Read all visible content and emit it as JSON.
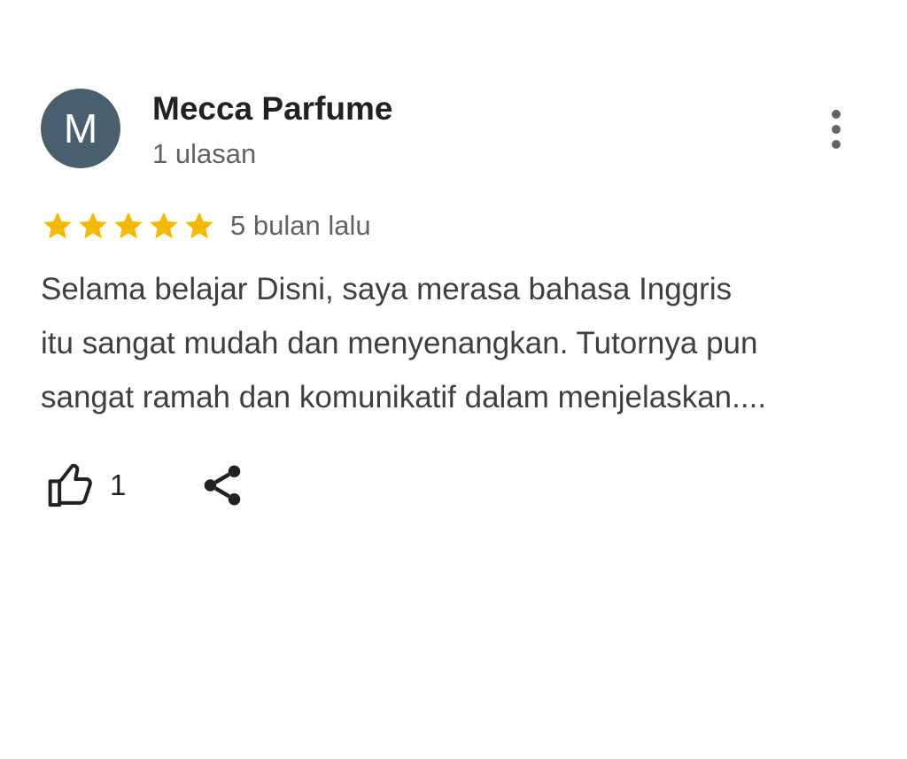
{
  "reviewer": {
    "initial": "M",
    "name": "Mecca Parfume",
    "review_count": "1 ulasan",
    "avatar_color": "#4a5f6e"
  },
  "menu": {
    "icon": "more-vert-icon"
  },
  "rating": {
    "stars": 5,
    "max_stars": 5,
    "star_color": "#f6b800",
    "date": "5 bulan lalu"
  },
  "review": {
    "text": "Selama belajar Disni, saya merasa bahasa Inggris\nitu sangat mudah dan menyenangkan. Tutornya pun\nsangat ramah dan komunikatif dalam menjelaskan...."
  },
  "actions": {
    "like_icon": "thumb-up-icon",
    "like_count": "1",
    "share_icon": "share-icon"
  }
}
